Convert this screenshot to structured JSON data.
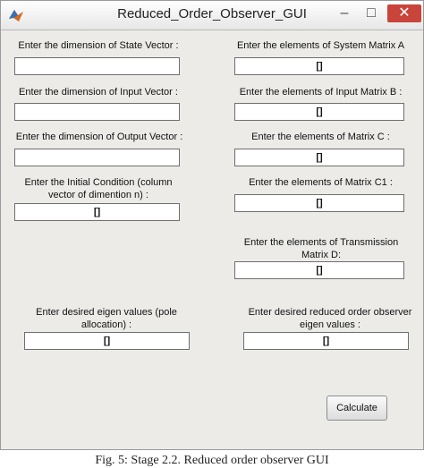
{
  "window": {
    "title": "Reduced_Order_Observer_GUI",
    "minimize": "–",
    "maximize": "□",
    "close": "✕"
  },
  "left": {
    "state_label": "Enter the dimension of State Vector :",
    "state_value": "",
    "input_label": "Enter the dimension of Input Vector :",
    "input_value": "",
    "output_label": "Enter the dimension of Output Vector :",
    "output_value": "",
    "initial_label": "Enter the Initial Condition (column vector of dimention n) :",
    "initial_value": "[]",
    "eigen_label": "Enter desired eigen values (pole allocation) :",
    "eigen_value": "[]"
  },
  "right": {
    "a_label": "Enter the elements of System Matrix A",
    "a_value": "[]",
    "b_label": "Enter the elements of Input Matrix B :",
    "b_value": "[]",
    "c_label": "Enter the elements of Matrix C :",
    "c_value": "[]",
    "c1_label": "Enter the elements of Matrix C1 :",
    "c1_value": "[]",
    "d_label": "Enter the elements of Transmission Matrix D:",
    "d_value": "[]",
    "observer_label": "Enter desired reduced order observer eigen values :",
    "observer_value": "[]"
  },
  "calculate_label": "Calculate",
  "caption": "Fig. 5: Stage 2.2. Reduced order observer GUI"
}
